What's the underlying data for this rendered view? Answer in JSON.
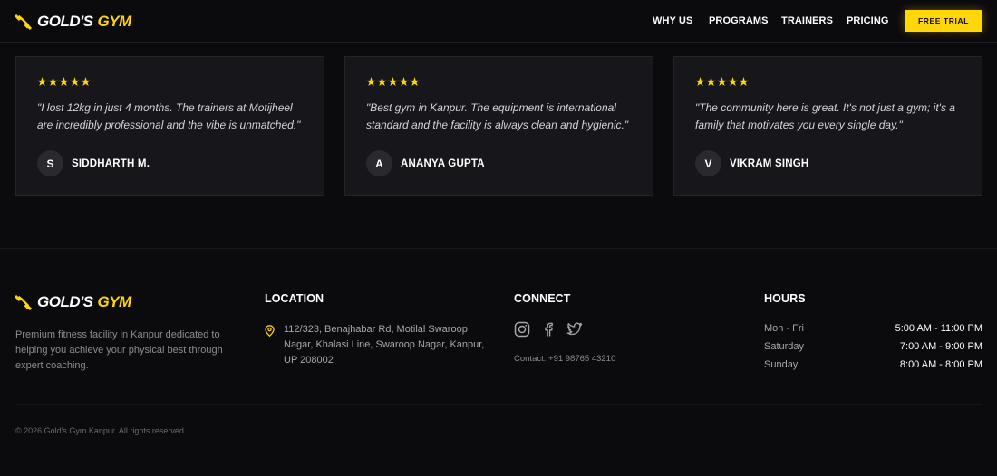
{
  "brand": {
    "word1": "GOLD'S",
    "word2": "GYM",
    "accent_color": "#ffd60a",
    "icon": "dumbbell-icon"
  },
  "nav": {
    "links": [
      {
        "label": "WHY US"
      },
      {
        "label": "PROGRAMS"
      },
      {
        "label": "TRAINERS"
      },
      {
        "label": "PRICING"
      }
    ],
    "cta_label": "FREE TRIAL"
  },
  "testimonials": [
    {
      "rating": 5,
      "quote": "\"I lost 12kg in just 4 months. The trainers at Motijheel are incredibly professional and the vibe is unmatched.\"",
      "initial": "S",
      "name": "SIDDHARTH M."
    },
    {
      "rating": 5,
      "quote": "\"Best gym in Kanpur. The equipment is international standard and the facility is always clean and hygienic.\"",
      "initial": "A",
      "name": "ANANYA GUPTA"
    },
    {
      "rating": 5,
      "quote": "\"The community here is great. It's not just a gym; it's a family that motivates you every single day.\"",
      "initial": "V",
      "name": "VIKRAM SINGH"
    }
  ],
  "footer": {
    "about": "Premium fitness facility in Kanpur dedicated to helping you achieve your physical best through expert coaching.",
    "location": {
      "title": "LOCATION",
      "icon": "map-pin-icon",
      "address": "112/323, Benajhabar Rd, Motilal Swaroop Nagar, Khalasi Line, Swaroop Nagar, Kanpur, UP 208002"
    },
    "connect": {
      "title": "CONNECT",
      "icons": [
        "instagram-icon",
        "facebook-icon",
        "twitter-icon"
      ],
      "contact": "Contact: +91 98765 43210"
    },
    "hours": {
      "title": "HOURS",
      "rows": [
        {
          "day": "Mon - Fri",
          "time": "5:00 AM - 11:00 PM"
        },
        {
          "day": "Saturday",
          "time": "7:00 AM - 9:00 PM"
        },
        {
          "day": "Sunday",
          "time": "8:00 AM - 8:00 PM"
        }
      ]
    },
    "copyright": "© 2026 Gold's Gym Kanpur. All rights reserved."
  }
}
